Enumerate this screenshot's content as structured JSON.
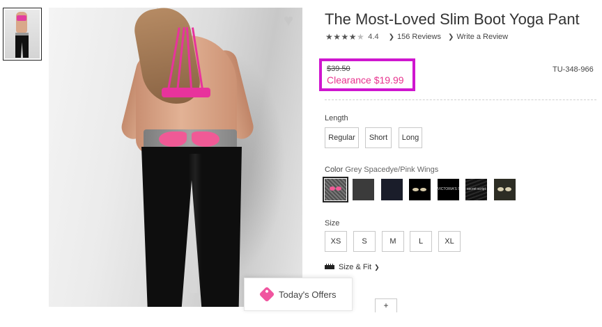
{
  "product": {
    "title": "The Most-Loved Slim Boot Yoga Pant",
    "rating_value": "4.4",
    "reviews_link": "156 Reviews",
    "write_review_link": "Write a Review",
    "original_price": "$39.50",
    "sale_price": "Clearance $19.99",
    "sku": "TU-348-966"
  },
  "length": {
    "label": "Length",
    "options": [
      "Regular",
      "Short",
      "Long"
    ]
  },
  "color": {
    "label": "Color",
    "selected_name": "Grey Spacedye/Pink Wings",
    "swatches": [
      {
        "name": "grey-spacedye-pink-wings",
        "color": "#5a5a5a"
      },
      {
        "name": "charcoal",
        "color": "#3b3b3b"
      },
      {
        "name": "navy",
        "color": "#1a1d2a"
      },
      {
        "name": "black-gold-wings",
        "color": "#000000"
      },
      {
        "name": "black-text-print",
        "color": "#000000",
        "text": "VICTORIA'S SECRET"
      },
      {
        "name": "black-script",
        "color": "#1a1a1a",
        "text": "secret script"
      },
      {
        "name": "olive-wings",
        "color": "#2d2d24"
      }
    ]
  },
  "size": {
    "label": "Size",
    "options": [
      "XS",
      "S",
      "M",
      "L",
      "XL"
    ],
    "size_fit_link": "Size & Fit"
  },
  "offers": {
    "label": "Today's Offers"
  },
  "partial": {
    "plus": "+"
  },
  "colors": {
    "accent_pink": "#e8338e",
    "highlight_box": "#cf16cf"
  }
}
